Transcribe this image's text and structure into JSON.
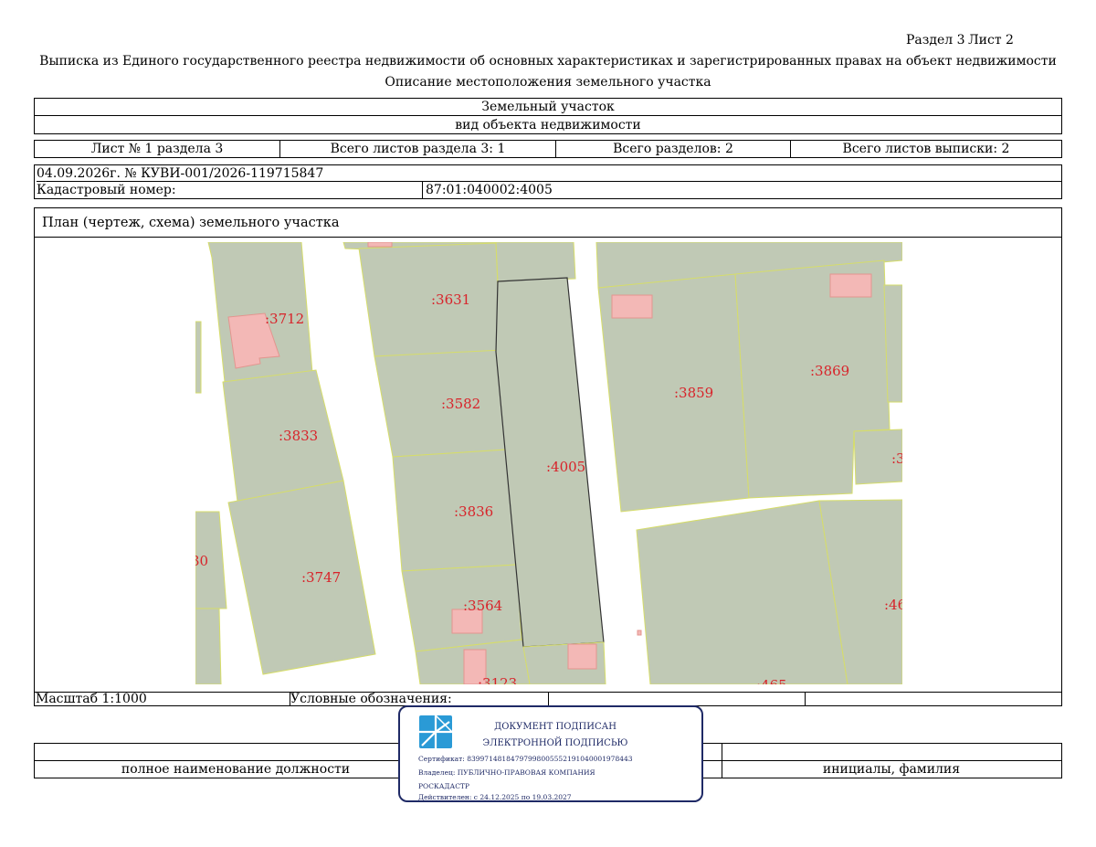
{
  "header": {
    "section_label": "Раздел 3",
    "sheet_label": "Лист 2",
    "title": "Выписка из Единого государственного реестра недвижимости об основных характеристиках и зарегистрированных правах на объект недвижимости",
    "subtitle": "Описание местоположения земельного участка"
  },
  "object": {
    "type": "Земельный участок",
    "type_caption": "вид объекта недвижимости"
  },
  "sheets": {
    "sheet_no": "Лист № 1 раздела 3",
    "total_sheets_section": "Всего листов раздела 3: 1",
    "total_sections": "Всего разделов: 2",
    "total_sheets_extract": "Всего листов выписки: 2"
  },
  "record": {
    "date_number": "04.09.2026г. № КУВИ-001/2026-119715847",
    "cadastral_label": "Кадастровый номер:",
    "cadastral_value": "87:01:040002:4005"
  },
  "plan": {
    "title": "План (чертеж, схема) земельного участка",
    "parcel_labels": [
      ":3712",
      ":3631",
      ":3582",
      ":3833",
      ":3836",
      ":4005",
      ":3747",
      ":3564",
      ":3123",
      ":3859",
      ":3869",
      ":465",
      ":46",
      ":3",
      "30"
    ]
  },
  "legend": {
    "scale": "Масштаб 1:1000",
    "symbols_label": "Условные обозначения:"
  },
  "signature": {
    "position_caption": "полное наименование должности",
    "name_caption": "инициалы, фамилия"
  },
  "stamp": {
    "line1": "ДОКУМЕНТ ПОДПИСАН",
    "line2": "ЭЛЕКТРОННОЙ ПОДПИСЬЮ",
    "certificate": "Сертификат: 83997148184797998005552191040001978443",
    "owner": "Владелец: ПУБЛИЧНО-ПРАВОВАЯ КОМПАНИЯ",
    "owner2": "РОСКАДАСТР",
    "valid": "Действителен: с 24.12.2025 по 19.03.2027"
  },
  "colors": {
    "parcel_fill": "#c0c9b5",
    "parcel_edge": "#d6dd6a",
    "building_fill": "#f3b8b6",
    "label_color": "#d8232a",
    "stamp_color": "#1f2a66"
  }
}
